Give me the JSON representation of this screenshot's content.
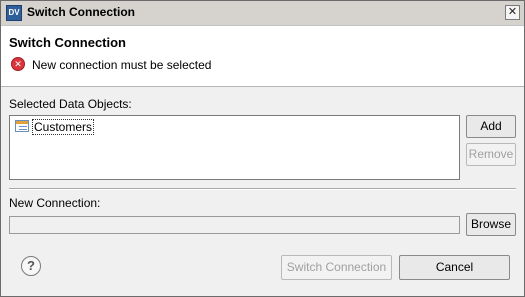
{
  "window": {
    "title": "Switch Connection",
    "app_icon_text": "DV",
    "close_glyph": "✕"
  },
  "header": {
    "title": "Switch Connection",
    "message": "New connection must be selected",
    "icon": "error-icon",
    "icon_glyph": "✕",
    "icon_color": "#d9363e"
  },
  "selected_objects": {
    "label": "Selected Data Objects:",
    "items": [
      {
        "label": "Customers",
        "icon": "table-icon"
      }
    ],
    "add_label": "Add",
    "remove_label": "Remove"
  },
  "new_connection": {
    "label": "New Connection:",
    "value": "",
    "browse_label": "Browse"
  },
  "footer": {
    "help_glyph": "?",
    "switch_label": "Switch Connection",
    "cancel_label": "Cancel"
  }
}
